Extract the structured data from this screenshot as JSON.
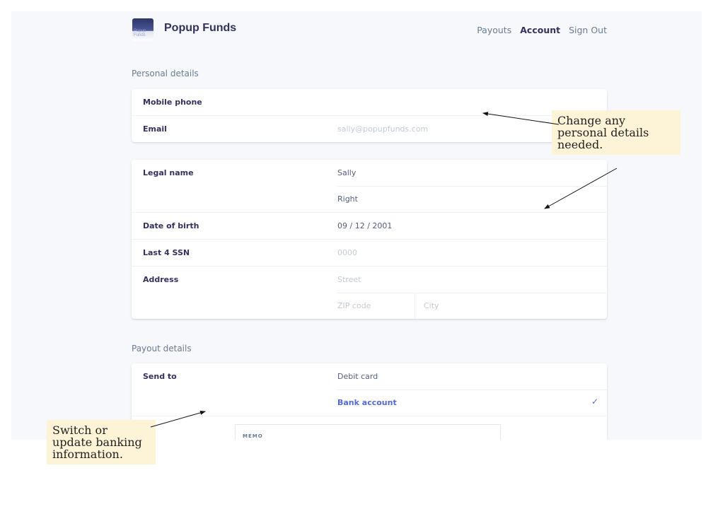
{
  "header": {
    "logo_text": "Popup Funds",
    "brand": "Popup Funds",
    "nav": [
      {
        "label": "Payouts",
        "active": false
      },
      {
        "label": "Account",
        "active": true
      },
      {
        "label": "Sign Out",
        "active": false
      }
    ]
  },
  "personal": {
    "title": "Personal details",
    "contact": [
      {
        "label": "Mobile phone",
        "value": ""
      },
      {
        "label": "Email",
        "placeholder": "sally@popupfunds.com"
      }
    ],
    "legal_name": {
      "label": "Legal name",
      "first": "Sally",
      "last": "Right"
    },
    "dob": {
      "label": "Date of birth",
      "value": "09 / 12 / 2001"
    },
    "ssn": {
      "label": "Last 4 SSN",
      "placeholder": "0000"
    },
    "address": {
      "label": "Address",
      "street": "Street",
      "zip": "ZIP code",
      "city": "City"
    }
  },
  "payout": {
    "title": "Payout details",
    "send_to_label": "Send to",
    "options": [
      {
        "label": "Debit card",
        "selected": false
      },
      {
        "label": "Bank account",
        "selected": true
      }
    ],
    "check": "✓",
    "memo_label": "MEMO"
  },
  "annotations": {
    "right": "Change any personal details needed.",
    "left": "Switch or update banking information."
  },
  "colors": {
    "accent": "#5469d4",
    "note_bg": "#fdf4d8",
    "background": "#f6f8fb"
  }
}
